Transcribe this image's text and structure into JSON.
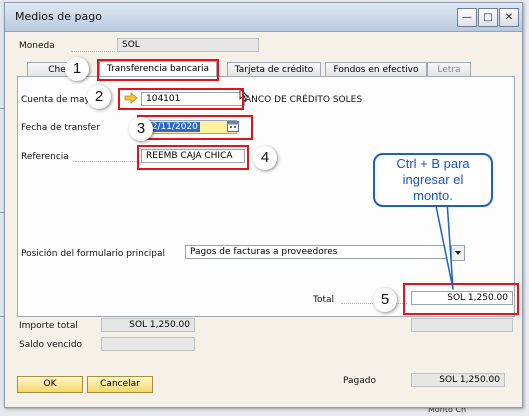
{
  "window": {
    "title": "Medios de pago",
    "controls": [
      "minimize",
      "maximize",
      "close"
    ]
  },
  "header": {
    "moneda_label": "Moneda",
    "moneda_value": "SOL"
  },
  "tabs": [
    {
      "label": "Cheque",
      "visible_label": "Che",
      "active": false
    },
    {
      "label": "Transferencia bancaria",
      "active": true
    },
    {
      "label": "Tarjeta de crédito",
      "active": false
    },
    {
      "label": "Fondos en efectivo",
      "active": false
    },
    {
      "label": "Letra",
      "active": false,
      "disabled": true
    }
  ],
  "transfer": {
    "cuenta_label": "Cuenta de may",
    "cuenta_value": "104101",
    "cuenta_name": "BANCO DE CRÉDITO SOLES",
    "cuenta_name_visible": "ANCO DE CRÉDITO SOLES",
    "fecha_label": "Fecha de transfer",
    "fecha_value": "12/11/2020",
    "referencia_label": "Referencia",
    "referencia_value": "REEMB CAJA CHICA",
    "posicion_label": "Posición del formulario principal",
    "posicion_value": "Pagos de facturas a proveedores",
    "total_label": "Total",
    "total_value": "SOL 1,250.00"
  },
  "summary": {
    "importe_label": "Importe total",
    "importe_value": "SOL 1,250.00",
    "saldo_label": "Saldo vencido",
    "saldo_value": "",
    "pagado_label": "Pagado",
    "pagado_value": "SOL 1,250.00"
  },
  "buttons": {
    "ok": "OK",
    "cancel": "Cancelar"
  },
  "annotations": {
    "steps": [
      "1",
      "2",
      "3",
      "4",
      "5"
    ],
    "callout": "Ctrl + B para ingresar el monto.",
    "color": "#e0141b",
    "callout_color": "#1a55c0"
  },
  "background": {
    "bottom_text": "Monto Ch"
  },
  "colors": {
    "button_accent": "#f4d86a",
    "date_highlight": "#fff0a0",
    "selection": "#316ac5"
  }
}
